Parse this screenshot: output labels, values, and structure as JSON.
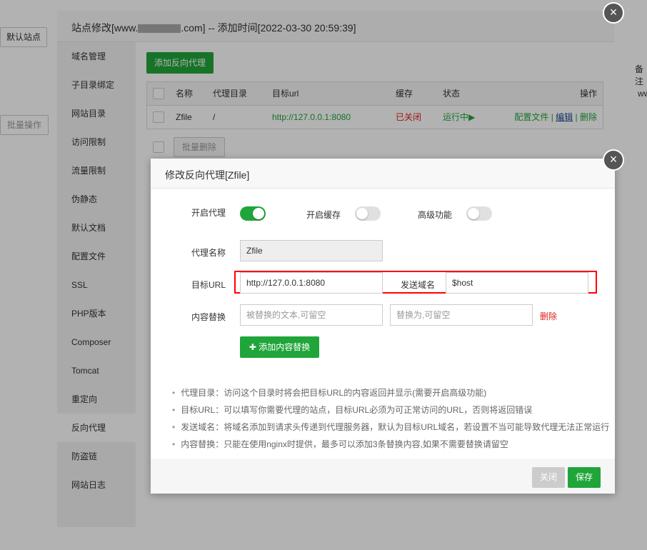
{
  "background": {
    "default_site": "默认站点",
    "batch_ops": "批量操作",
    "col_remark": "备注",
    "row_text": "ww"
  },
  "outer": {
    "title_prefix": "站点修改[www.",
    "title_suffix": ".com] -- 添加时间[2022-03-30 20:59:39]",
    "sidebar": [
      "域名管理",
      "子目录绑定",
      "网站目录",
      "访问限制",
      "流量限制",
      "伪静态",
      "默认文档",
      "配置文件",
      "SSL",
      "PHP版本",
      "Composer",
      "Tomcat",
      "重定向",
      "反向代理",
      "防盗链",
      "网站日志"
    ],
    "active": "反向代理",
    "add_button": "添加反向代理",
    "table": {
      "headers": [
        "名称",
        "代理目录",
        "目标url",
        "缓存",
        "状态",
        "操作"
      ],
      "rows": [
        {
          "name": "Zfile",
          "dir": "/",
          "url": "http://127.0.0.1:8080",
          "cache": "已关闭",
          "status": "运行中▶",
          "actions": [
            "配置文件",
            "编辑",
            "删除"
          ]
        }
      ]
    },
    "batch_delete": "批量删除"
  },
  "inner": {
    "title": "修改反向代理[Zfile]",
    "toggles": [
      {
        "label": "开启代理",
        "on": true
      },
      {
        "label": "开启缓存",
        "on": false
      },
      {
        "label": "高级功能",
        "on": false
      }
    ],
    "name_label": "代理名称",
    "name_value": "Zfile",
    "url_label": "目标URL",
    "url_value": "http://127.0.0.1:8080",
    "host_label": "发送域名",
    "host_value": "$host",
    "replace_label": "内容替换",
    "replace_from_placeholder": "被替换的文本,可留空",
    "replace_to_placeholder": "替换为,可留空",
    "delete": "删除",
    "add_replace": "添加内容替换",
    "notes": [
      "代理目录：访问这个目录时将会把目标URL的内容返回并显示(需要开启高级功能)",
      "目标URL：可以填写你需要代理的站点，目标URL必须为可正常访问的URL，否则将返回错误",
      "发送域名：将域名添加到请求头传递到代理服务器，默认为目标URL域名，若设置不当可能导致代理无法正常运行",
      "内容替换：只能在使用nginx时提供，最多可以添加3条替换内容,如果不需要替换请留空"
    ],
    "close": "关闭",
    "save": "保存"
  },
  "colors": {
    "accent": "#20a53a",
    "danger": "#e02020",
    "highlight_box": "#ff0000"
  }
}
